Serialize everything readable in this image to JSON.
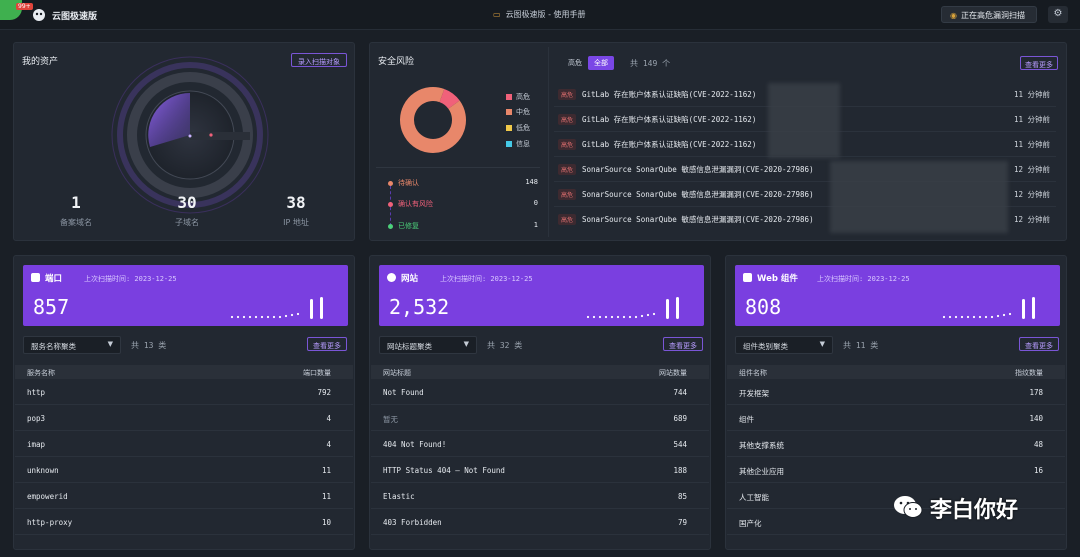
{
  "topbar": {
    "badge": "99+",
    "app_title": "云图极速版",
    "manual": "云图极速版 - 使用手册",
    "scan_button": "正在高危漏洞扫描"
  },
  "assets": {
    "title": "我的资产",
    "import_button": "录入扫描对象",
    "stats": [
      {
        "value": "1",
        "label": "备案域名"
      },
      {
        "value": "30",
        "label": "子域名"
      },
      {
        "value": "38",
        "label": "IP 地址"
      }
    ]
  },
  "risk": {
    "title": "安全风险",
    "legend": [
      {
        "label": "高危",
        "color": "#f0617a"
      },
      {
        "label": "中危",
        "color": "#e8876a"
      },
      {
        "label": "低危",
        "color": "#f0c94a"
      },
      {
        "label": "信息",
        "color": "#45c9e6"
      }
    ],
    "donut": {
      "high": 14,
      "medium": 135,
      "low": 0,
      "info": 0
    },
    "status": [
      {
        "label": "待确认",
        "value": "148",
        "color": "#e8876a"
      },
      {
        "label": "确认有风险",
        "value": "0",
        "color": "#f0617a"
      },
      {
        "label": "已修复",
        "value": "1",
        "color": "#4cd07a"
      }
    ],
    "tabs": [
      "高危",
      "全部"
    ],
    "total": "共 149 个",
    "more": "查看更多",
    "vulns": [
      {
        "sev": "高危",
        "name": "GitLab 存在账户体系认证缺陷(CVE-2022-1162)",
        "time": "11 分钟前"
      },
      {
        "sev": "高危",
        "name": "GitLab 存在账户体系认证缺陷(CVE-2022-1162)",
        "time": "11 分钟前"
      },
      {
        "sev": "高危",
        "name": "GitLab 存在账户体系认证缺陷(CVE-2022-1162)",
        "time": "11 分钟前"
      },
      {
        "sev": "高危",
        "name": "SonarSource SonarQube 敏感信息泄漏漏洞(CVE-2020-27986)",
        "time": "12 分钟前"
      },
      {
        "sev": "高危",
        "name": "SonarSource SonarQube 敏感信息泄漏漏洞(CVE-2020-27986)",
        "time": "12 分钟前"
      },
      {
        "sev": "高危",
        "name": "SonarSource SonarQube 敏感信息泄漏漏洞(CVE-2020-27986)",
        "time": "12 分钟前"
      }
    ]
  },
  "panels": [
    {
      "title": "端口",
      "last_scan": "上次扫描时间: 2023-12-25",
      "total": "857",
      "select": "服务名称聚类",
      "count": "共 13 类",
      "more": "查看更多",
      "col1": "服务名称",
      "col2": "端口数量",
      "rows": [
        {
          "name": "http",
          "value": "792"
        },
        {
          "name": "pop3",
          "value": "4"
        },
        {
          "name": "imap",
          "value": "4"
        },
        {
          "name": "unknown",
          "value": "11"
        },
        {
          "name": "empowerid",
          "value": "11"
        },
        {
          "name": "http-proxy",
          "value": "10"
        }
      ]
    },
    {
      "title": "网站",
      "last_scan": "上次扫描时间: 2023-12-25",
      "total": "2,532",
      "select": "网站标题聚类",
      "count": "共 32 类",
      "more": "查看更多",
      "col1": "网站标题",
      "col2": "网站数量",
      "rows": [
        {
          "name": "Not Found",
          "value": "744"
        },
        {
          "name": "暂无",
          "value": "689"
        },
        {
          "name": "404 Not Found!",
          "value": "544"
        },
        {
          "name": "HTTP Status 404 – Not Found",
          "value": "188"
        },
        {
          "name": "Elastic",
          "value": "85"
        },
        {
          "name": "403 Forbidden",
          "value": "79"
        }
      ]
    },
    {
      "title": "Web 组件",
      "last_scan": "上次扫描时间: 2023-12-25",
      "total": "808",
      "select": "组件类别聚类",
      "count": "共 11 类",
      "more": "查看更多",
      "col1": "组件名称",
      "col2": "指纹数量",
      "rows": [
        {
          "name": "开发框架",
          "value": "178"
        },
        {
          "name": "组件",
          "value": "140"
        },
        {
          "name": "其他支撑系统",
          "value": "48"
        },
        {
          "name": "其他企业应用",
          "value": "16"
        },
        {
          "name": "人工智能",
          "value": ""
        },
        {
          "name": "国产化",
          "value": ""
        }
      ]
    }
  ],
  "watermark": {
    "text": "李白你好"
  }
}
